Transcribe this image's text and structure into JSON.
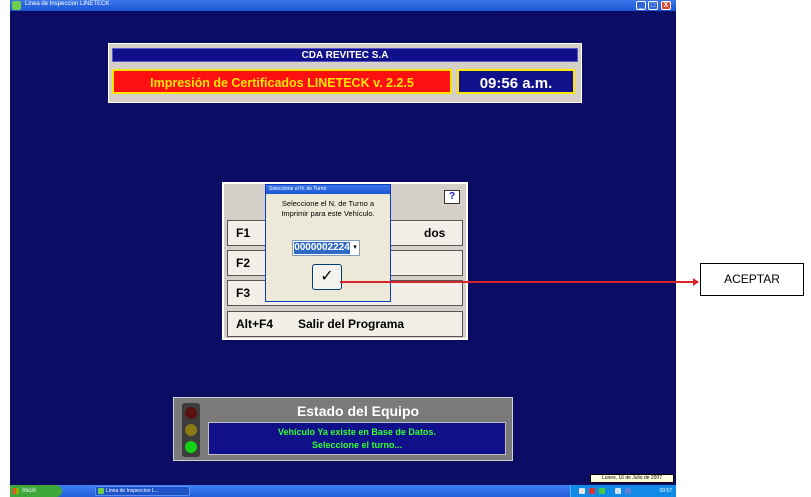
{
  "window": {
    "title": "Linea de Inspeccion LINETECK",
    "controls": {
      "minimize": "_",
      "maximize": "□",
      "close": "X"
    }
  },
  "header": {
    "company": "CDA REVITEC S.A",
    "app_title": "Impresión de Certificados LINETECK v. 2.2.5",
    "clock": "09:56 a.m."
  },
  "menu": {
    "help_icon": "?",
    "items": [
      {
        "key": "F1",
        "label": "dos"
      },
      {
        "key": "F2",
        "label": ""
      },
      {
        "key": "F3",
        "label": ""
      },
      {
        "key": "Alt+F4",
        "label": "Salir del Programa"
      }
    ]
  },
  "dialog": {
    "title": "Seleccione el N. de Turno",
    "prompt": "Seleccione el N. de Turno a Imprimir para este Vehículo.",
    "turn_value": "0000002224",
    "dropdown_arrow": "▾",
    "accept_symbol": "✓"
  },
  "status": {
    "title": "Estado del Equipo",
    "line1": "Vehículo Ya existe en Base de Datos.",
    "line2": "Seleccione el turno...",
    "light": {
      "red": "off",
      "yellow": "off",
      "green": "on"
    }
  },
  "taskbar": {
    "start_label": "Inicio",
    "task_item": "Linea de Inspeccion L...",
    "date_tooltip": "Lunes, 16 de Julio de 2007",
    "clock": "09:57"
  },
  "annotation": {
    "label": "ACEPTAR",
    "color": "#d9232b"
  }
}
